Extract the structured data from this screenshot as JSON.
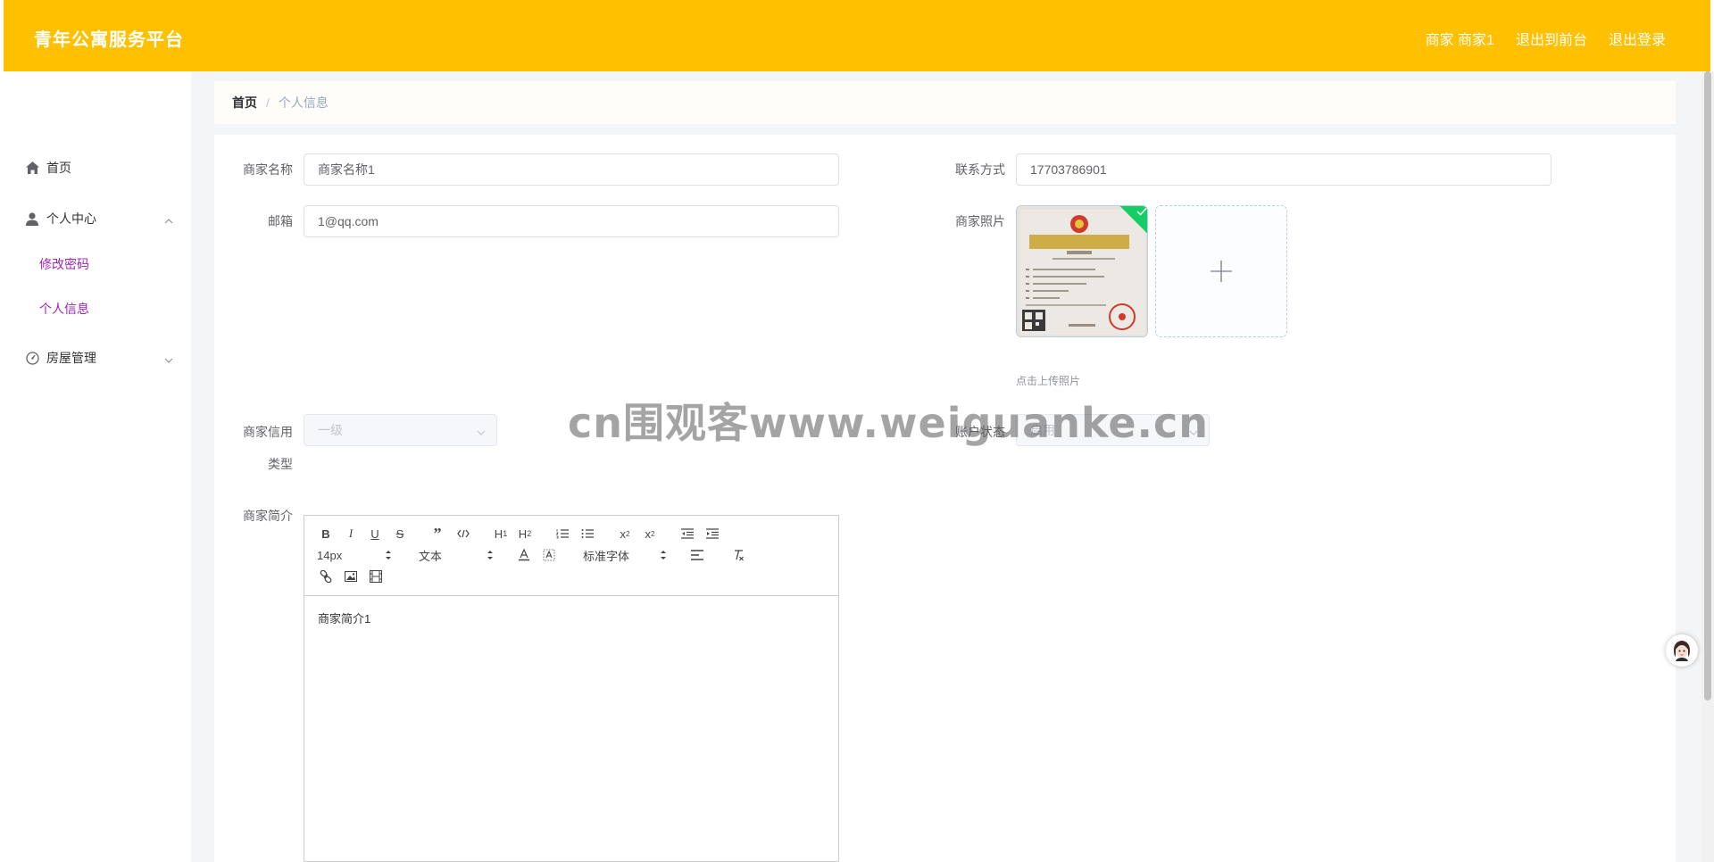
{
  "header": {
    "brand": "青年公寓服务平台",
    "user": "商家 商家1",
    "front_link": "退出到前台",
    "logout": "退出登录"
  },
  "sidebar": {
    "items": [
      {
        "label": "首页",
        "icon": "home-icon"
      },
      {
        "label": "个人中心",
        "icon": "user-icon",
        "expanded": true,
        "children": [
          {
            "label": "修改密码"
          },
          {
            "label": "个人信息"
          }
        ]
      },
      {
        "label": "房屋管理",
        "icon": "dashboard-icon",
        "expanded": false
      }
    ]
  },
  "breadcrumb": {
    "home": "首页",
    "separator": "/",
    "current": "个人信息"
  },
  "form": {
    "merchant_name_label": "商家名称",
    "merchant_name_value": "商家名称1",
    "contact_label": "联系方式",
    "contact_value": "17703786901",
    "email_label": "邮箱",
    "email_value": "1@qq.com",
    "photo_label": "商家照片",
    "photo_tip": "点击上传照片",
    "credit_label_1": "商家信用",
    "credit_label_2": "类型",
    "credit_value": "一级",
    "status_label": "账户状态",
    "status_value": "启用",
    "intro_label": "商家简介"
  },
  "editor": {
    "font_size": "14px",
    "header_picker": "文本",
    "font_family": "标准字体",
    "content": "商家简介1"
  },
  "watermark": "cn围观客www.weiguanke.cn",
  "colors": {
    "header_bg": "#ffc000",
    "submenu_text": "#9c27b0",
    "upload_success": "#13ce66"
  }
}
